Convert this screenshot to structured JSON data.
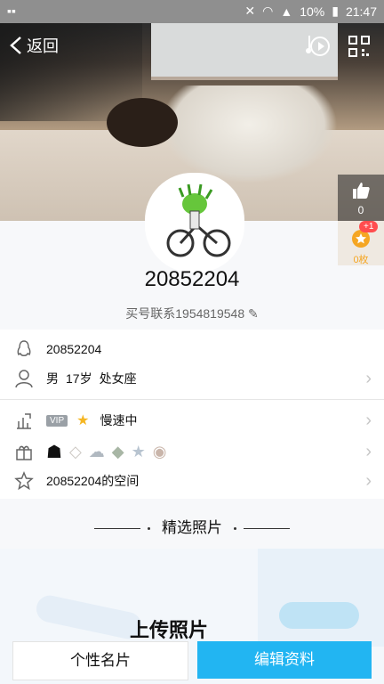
{
  "status_bar": {
    "battery": "10%",
    "time": "21:47"
  },
  "header": {
    "back_label": "返回"
  },
  "like": {
    "count": "0"
  },
  "coins": {
    "badge": "+1",
    "label": "0枚"
  },
  "profile": {
    "nickname": "20852204",
    "signature": "买号联系1954819548"
  },
  "info": {
    "qq": "20852204",
    "gender": "男",
    "age": "17岁",
    "zodiac": "处女座",
    "vip_label": "VIP",
    "speed_text": "慢速中",
    "space_text": "20852204的空间"
  },
  "section": {
    "featured_photos": "精选照片",
    "upload_text": "上传照片"
  },
  "bottom": {
    "left_button": "个性名片",
    "right_button": "编辑资料"
  },
  "colors": {
    "accent": "#22b5f2",
    "coin": "#f5a623",
    "badge": "#ff4d4f"
  }
}
